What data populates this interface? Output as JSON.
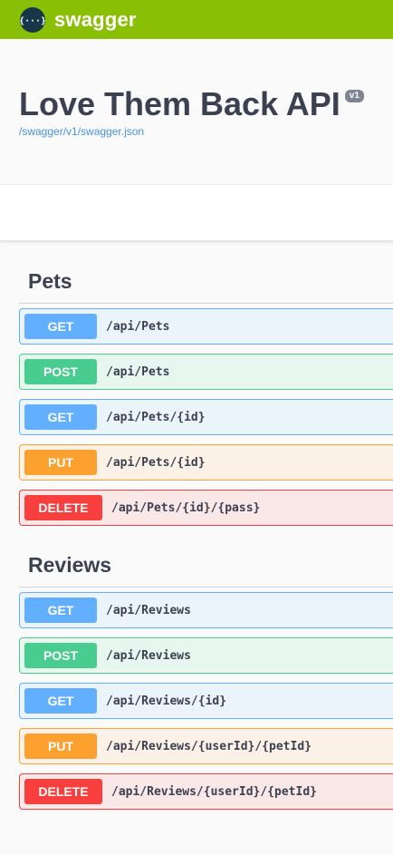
{
  "topbar": {
    "logo_glyph": "{···}",
    "brand": "swagger",
    "bg_color": "#89bf04"
  },
  "info": {
    "title": "Love Them Back API",
    "version": "v1",
    "spec_url": "/swagger/v1/swagger.json"
  },
  "tags": [
    {
      "name": "Pets",
      "operations": [
        {
          "method": "GET",
          "path": "/api/Pets"
        },
        {
          "method": "POST",
          "path": "/api/Pets"
        },
        {
          "method": "GET",
          "path": "/api/Pets/{id}"
        },
        {
          "method": "PUT",
          "path": "/api/Pets/{id}"
        },
        {
          "method": "DELETE",
          "path": "/api/Pets/{id}/{pass}"
        }
      ]
    },
    {
      "name": "Reviews",
      "operations": [
        {
          "method": "GET",
          "path": "/api/Reviews"
        },
        {
          "method": "POST",
          "path": "/api/Reviews"
        },
        {
          "method": "GET",
          "path": "/api/Reviews/{id}"
        },
        {
          "method": "PUT",
          "path": "/api/Reviews/{userId}/{petId}"
        },
        {
          "method": "DELETE",
          "path": "/api/Reviews/{userId}/{petId}"
        }
      ]
    }
  ],
  "method_colors": {
    "GET": "#61affe",
    "POST": "#49cc90",
    "PUT": "#fca130",
    "DELETE": "#f93e3e"
  }
}
